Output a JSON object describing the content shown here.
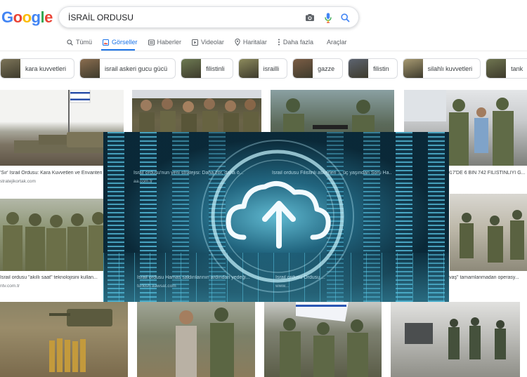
{
  "header": {
    "logo_letters": [
      "G",
      "o",
      "o",
      "g",
      "l",
      "e"
    ],
    "logo_colors": [
      "#4285F4",
      "#EA4335",
      "#FBBC05",
      "#4285F4",
      "#34A853",
      "#EA4335"
    ],
    "search_value": "İSRAİL ORDUSU"
  },
  "tabs": [
    {
      "label": "Tümü",
      "icon": "search-icon"
    },
    {
      "label": "Görseller",
      "icon": "image-icon",
      "active": true
    },
    {
      "label": "Haberler",
      "icon": "news-icon"
    },
    {
      "label": "Videolar",
      "icon": "video-icon"
    },
    {
      "label": "Haritalar",
      "icon": "map-pin-icon"
    },
    {
      "label": "Daha fazla",
      "icon": "more-icon"
    }
  ],
  "tools_label": "Araçlar",
  "chips": [
    {
      "label": "kara kuvvetleri"
    },
    {
      "label": "israil askeri gucu gücü"
    },
    {
      "label": "filistinli"
    },
    {
      "label": "israilli"
    },
    {
      "label": "gazze"
    },
    {
      "label": "filistin"
    },
    {
      "label": "silahlı kuvvetleri"
    },
    {
      "label": "tank"
    }
  ],
  "results": [
    {
      "title": "'Sır' İsrail Ordusu: Kara Kuvvetleri ve Envanteri - St...",
      "source": "stratejikortak.com"
    },
    {
      "title": "İsrail ordusu'nun yeni stratejisi: Daha zor, daha ö...",
      "source": "aa.com.tr"
    },
    {
      "title": "İsrail ordusu Filistinli askerleri ... üç yaşından Soru Ha...",
      "source": ""
    },
    {
      "title": "İSRAİL ORDUSU 2017'DE 6 BİN 742 FİLİSTİNLİYİ G...",
      "source": ""
    },
    {
      "title": "İsrail ordusu \"akıllı saat\" teknolojisini kullan...",
      "source": "ntv.com.tr"
    },
    {
      "title": "İsrail ordusu Hamas saldırılarının ardından yedeği...",
      "source": "turkish.aawsat.com"
    },
    {
      "title": "İsrail ordusu Ordusu ...",
      "source": "www..."
    },
    {
      "title": "İsrail ordusu \"Savaş\" tamamlanmadan operasy...",
      "source": ""
    }
  ]
}
